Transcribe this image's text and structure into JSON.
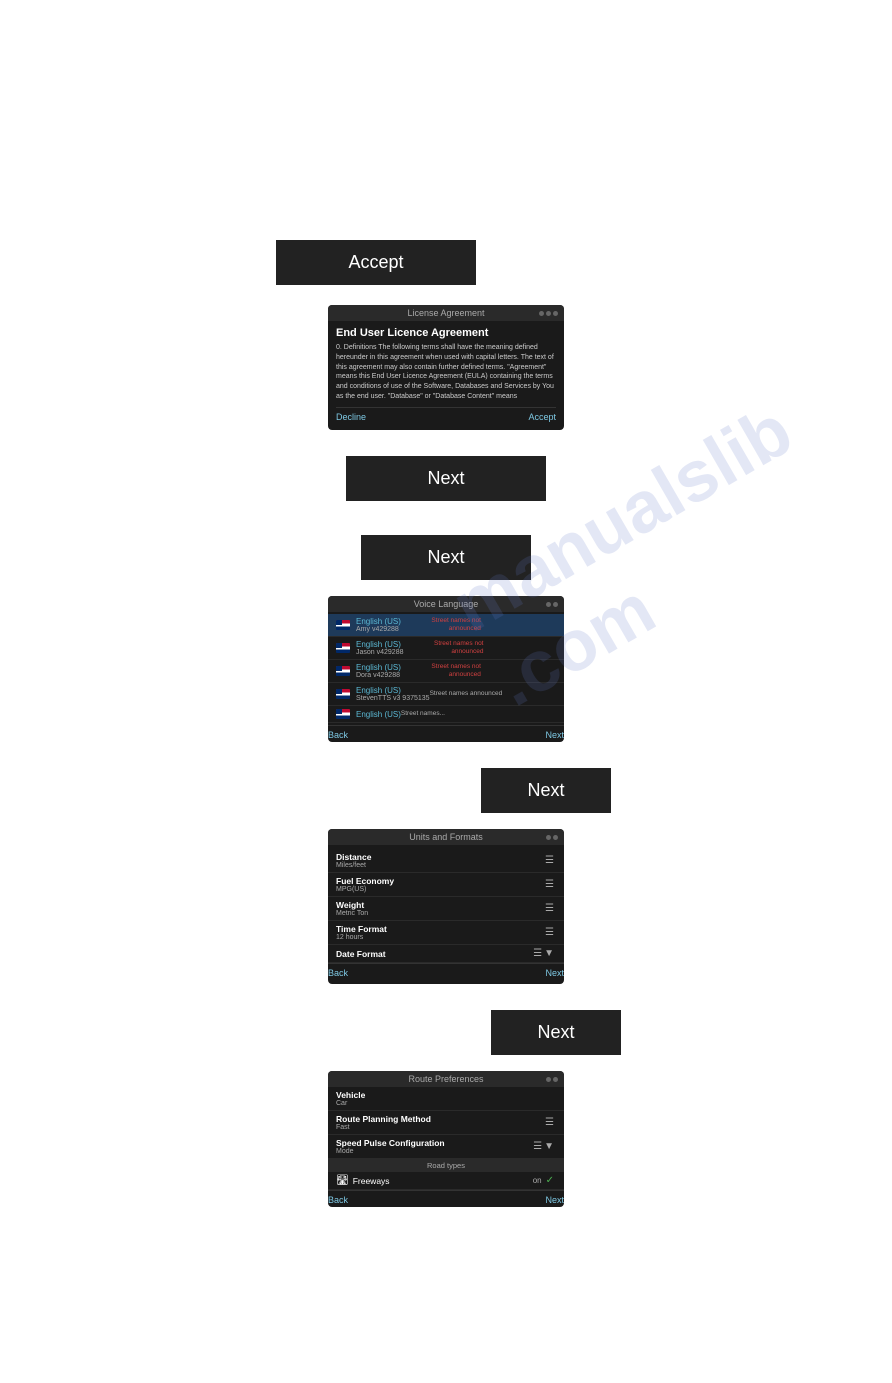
{
  "watermark": {
    "line1": "manualslib",
    "line2": ".com"
  },
  "accept_button": {
    "label": "Accept"
  },
  "license_screen": {
    "header": "License Agreement",
    "title": "End User Licence Agreement",
    "body": "0. Definitions\nThe following terms shall have the meaning defined hereunder in this agreement when used with capital letters. The text of this agreement may also contain further defined terms. \"Agreement\" means this End User Licence Agreement (EULA) containing the terms and conditions of use of the Software, Databases and Services by You as the end user. \"Database\" or \"Database Content\" means geographically...",
    "decline_label": "Decline",
    "accept_label": "Accept"
  },
  "next_buttons": {
    "btn1_label": "Next",
    "btn2_label": "Next",
    "btn3_label": "Next",
    "btn4_label": "Next"
  },
  "voice_screen": {
    "header": "Voice Language",
    "languages": [
      {
        "name": "English (US)",
        "sub": "Amy v429288",
        "note": "Street names not announced",
        "selected": true
      },
      {
        "name": "English (US)",
        "sub": "Jason v429288",
        "note": "Street names not announced",
        "selected": false
      },
      {
        "name": "English (US)",
        "sub": "Dora v429288",
        "note": "Street names not announced",
        "selected": false
      },
      {
        "name": "English (US)",
        "sub": "StevenTTS v3 9375135",
        "note": "Street names announced",
        "selected": false
      },
      {
        "name": "English (US)",
        "sub": "",
        "note": "Street names...",
        "selected": false
      }
    ],
    "back_label": "Back",
    "next_label": "Next"
  },
  "units_screen": {
    "header": "Units and Formats",
    "items": [
      {
        "label": "Distance",
        "sub": "Miles/feet"
      },
      {
        "label": "Fuel Economy",
        "sub": "MPG(US)"
      },
      {
        "label": "Weight",
        "sub": "Metric Ton"
      },
      {
        "label": "Time Format",
        "sub": "12 hours"
      },
      {
        "label": "Date Format",
        "sub": ""
      }
    ],
    "back_label": "Back",
    "next_label": "Next"
  },
  "route_screen": {
    "header": "Route Preferences",
    "items": [
      {
        "label": "Vehicle",
        "sub": "Car"
      },
      {
        "label": "Route Planning Method",
        "sub": "Fast"
      },
      {
        "label": "Speed Pulse Configuration",
        "sub": "Mode"
      }
    ],
    "road_types_header": "Road types",
    "freeway": {
      "label": "Freeways",
      "status": "on"
    },
    "back_label": "Back",
    "next_label": "Next"
  }
}
